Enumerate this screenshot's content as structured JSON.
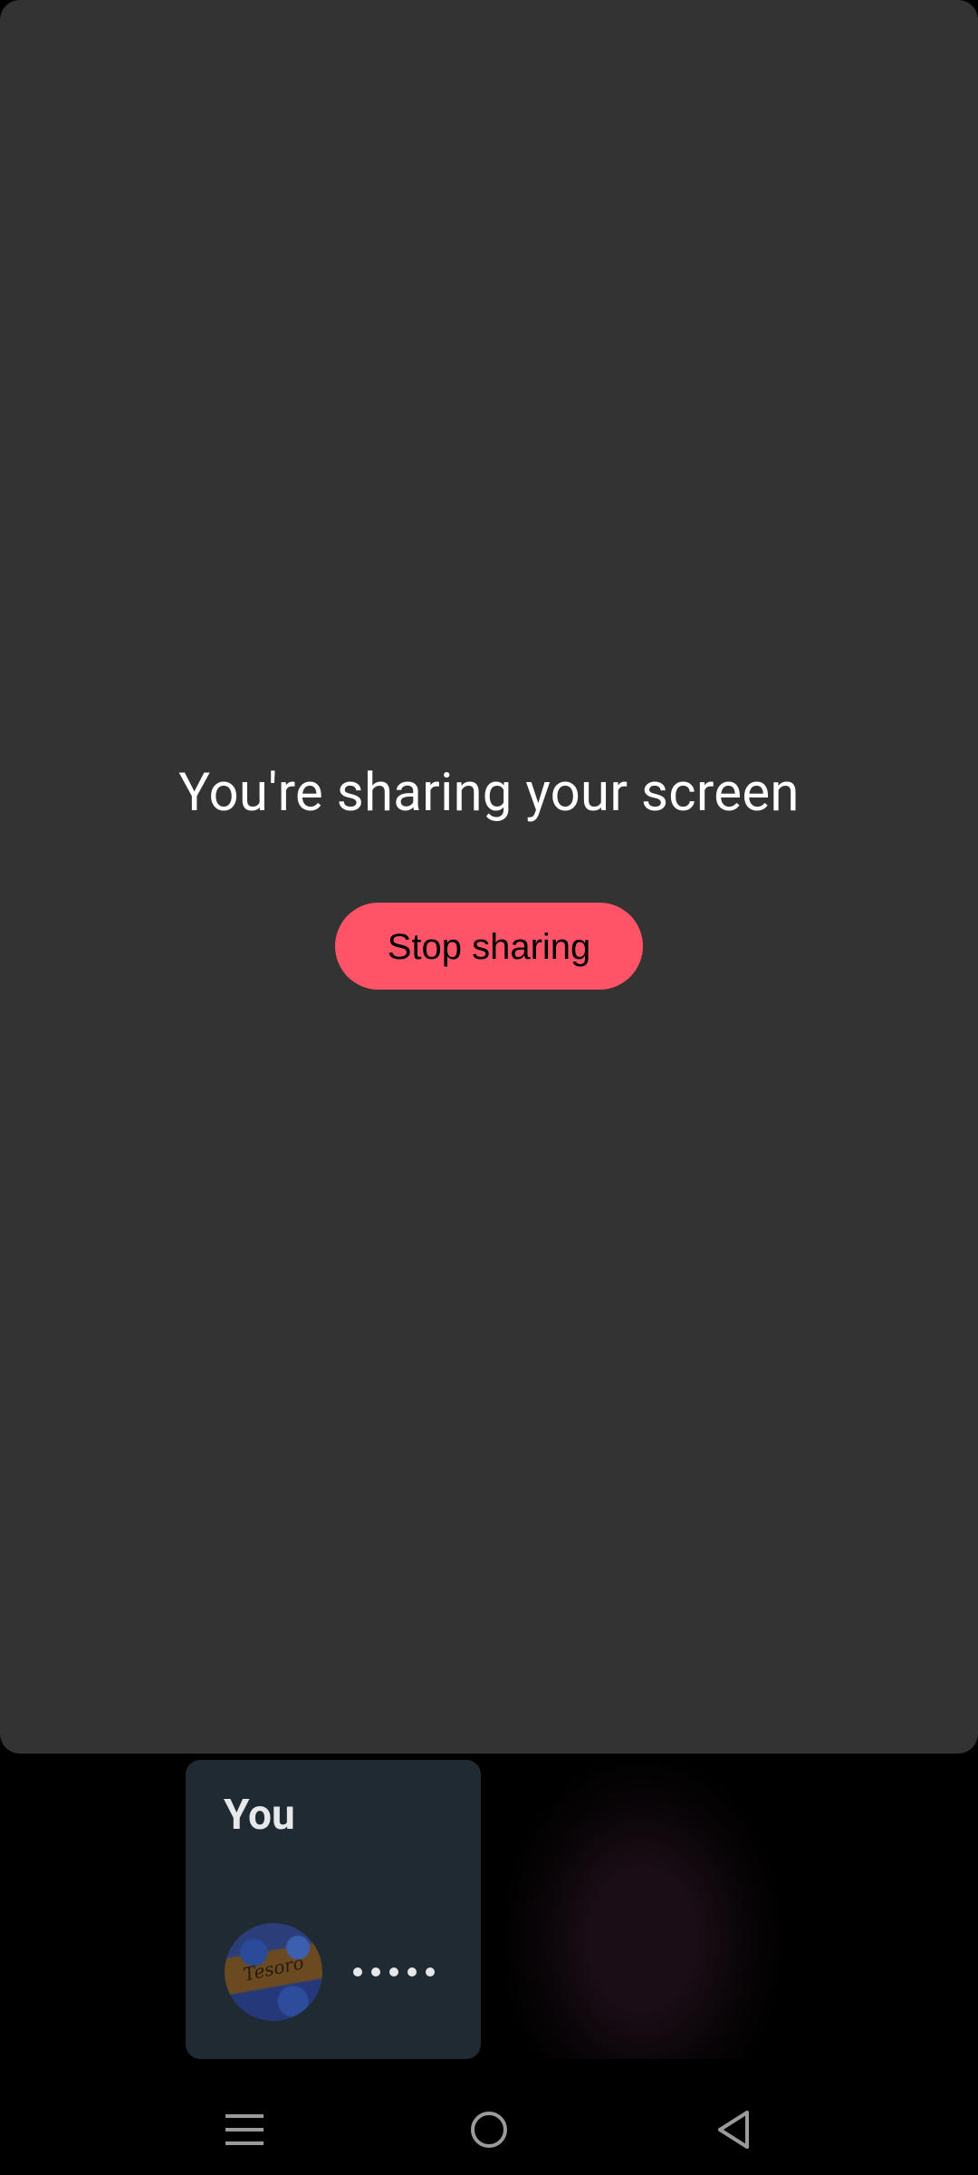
{
  "share": {
    "message": "You're sharing your screen",
    "stop_label": "Stop sharing"
  },
  "participants": {
    "self_name": "You",
    "more_icon": "more-horizontal-icon"
  },
  "navbar": {
    "menu_icon": "menu-icon",
    "home_icon": "home-icon",
    "back_icon": "back-icon"
  },
  "colors": {
    "panel_bg": "#333333",
    "stop_button": "#ff5468",
    "tile_bg": "#1f2a33"
  }
}
